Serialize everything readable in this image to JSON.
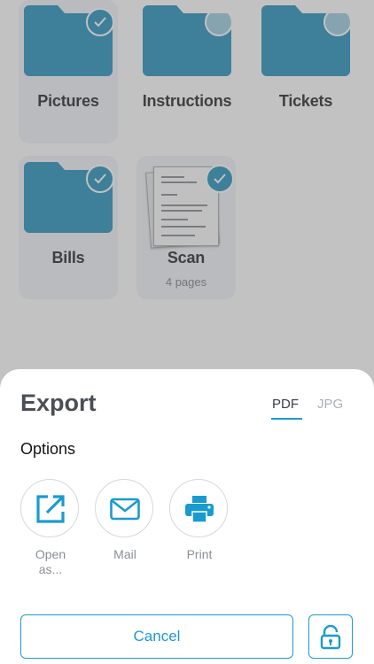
{
  "files": [
    {
      "name": "Pictures",
      "selected": true,
      "kind": "folder-icon"
    },
    {
      "name": "Instructions",
      "selected": false,
      "kind": "folder-icon"
    },
    {
      "name": "Tickets",
      "selected": false,
      "kind": "folder-icon"
    },
    {
      "name": "Bills",
      "selected": true,
      "kind": "folder-icon"
    },
    {
      "name": "Scan",
      "subtitle": "4 pages",
      "selected": true,
      "kind": "document-thumbnail"
    }
  ],
  "export": {
    "title": "Export",
    "formats": [
      "PDF",
      "JPG"
    ],
    "selected_format": "PDF",
    "options_label": "Options",
    "options": [
      {
        "label": "Open as...",
        "icon": "open-external-icon"
      },
      {
        "label": "Mail",
        "icon": "mail-icon"
      },
      {
        "label": "Print",
        "icon": "printer-icon"
      }
    ],
    "cancel_label": "Cancel",
    "lock_icon": "lock-icon"
  },
  "colors": {
    "accent": "#1a9bcf",
    "folder": "#0f86b6",
    "overlay": "rgba(120,120,120,0.45)"
  }
}
